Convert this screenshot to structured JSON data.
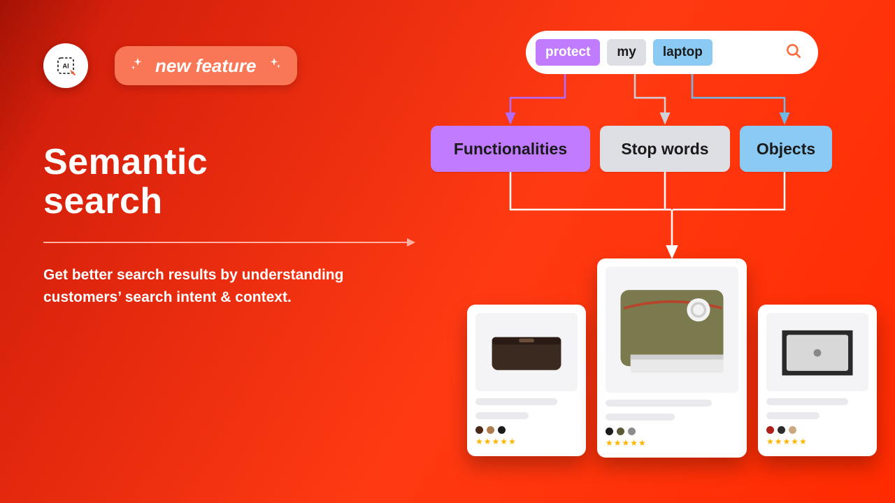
{
  "badge": {
    "label": "new feature"
  },
  "title_line1": "Semantic",
  "title_line2": "search",
  "subtitle": "Get better search results by understanding customers’ search intent & context.",
  "search": {
    "tokens": [
      {
        "text": "protect",
        "kind": "purple"
      },
      {
        "text": "my",
        "kind": "grey"
      },
      {
        "text": "laptop",
        "kind": "blue"
      }
    ]
  },
  "categories": {
    "functionalities": "Functionalities",
    "stopwords": "Stop words",
    "objects": "Objects"
  },
  "connectors": {
    "colors": {
      "purple": "#b06bff",
      "grey": "#cfd0d8",
      "blue": "#6fb9e8",
      "white": "#ffffff"
    }
  },
  "products": {
    "a": {
      "rating": "★★★★★"
    },
    "b": {
      "rating": "★★★★★"
    },
    "c": {
      "rating": "★★★★★"
    }
  }
}
